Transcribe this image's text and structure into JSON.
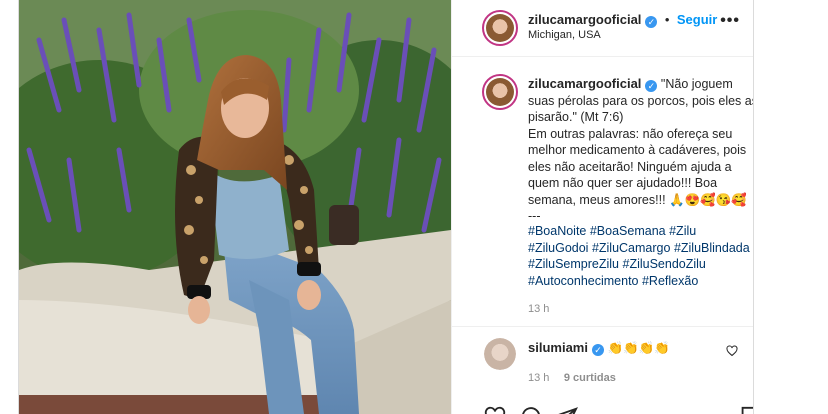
{
  "post": {
    "username": "zilucamargooficial",
    "follow_label": "Seguir",
    "location": "Michigan, USA",
    "caption": "\"Não joguem suas pérolas para os porcos, pois eles as pisarão.\" (Mt 7:6)\nEm outras palavras: não ofereça seu melhor medicamento à cadáveres, pois eles não aceitarão! Ninguém ajuda a quem não quer ser ajudado!!! Boa semana, meus amores!!! 🙏😍🥰😘🥰\n---",
    "hashtags": [
      "#BoaNoite",
      "#BoaSemana",
      "#Zilu",
      "#ZiluGodoi",
      "#ZiluCamargo",
      "#ZiluBlindada",
      "#ZiluSempreZilu",
      "#ZiluSendoZilu",
      "#Autoconhecimento",
      "#Reflexão"
    ],
    "caption_time": "13 h"
  },
  "comment": {
    "username": "silumiami",
    "text": "👏👏👏👏",
    "time": "13 h",
    "likes": "9 curtidas"
  },
  "colors": {
    "accent": "#0095f6",
    "verified": "#3897f0",
    "hashtag": "#00376b",
    "muted": "#8e8e8e"
  },
  "icons": [
    "more-options-icon",
    "verified-badge-icon",
    "heart-icon",
    "comment-icon",
    "share-icon",
    "save-icon"
  ]
}
